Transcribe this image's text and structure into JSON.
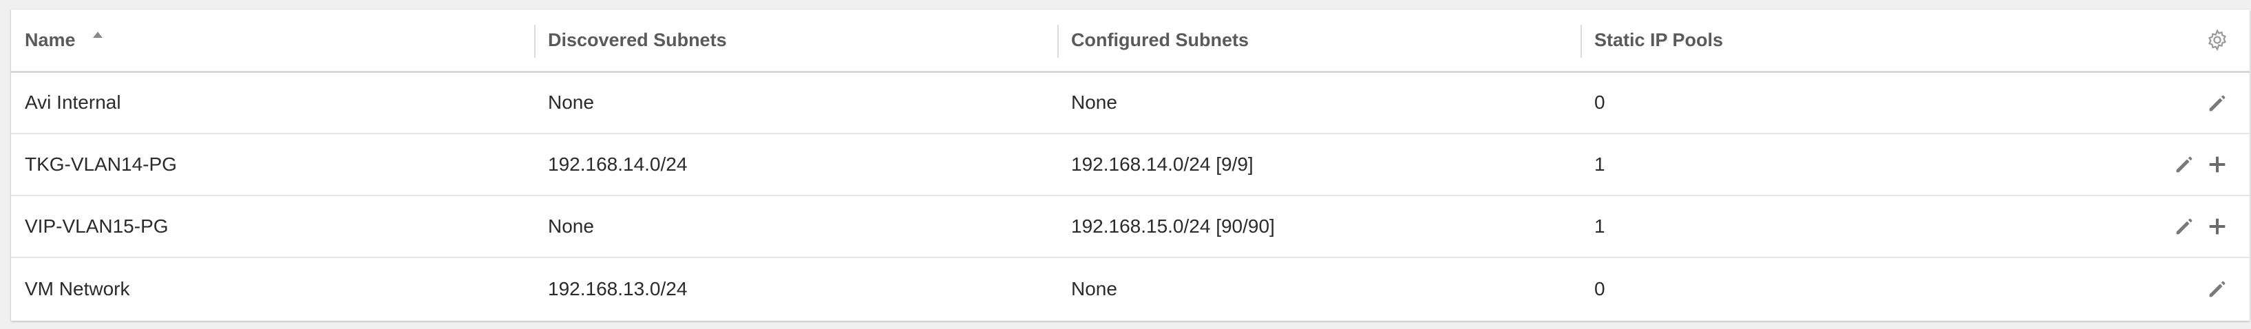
{
  "table": {
    "columns": {
      "name": "Name",
      "discovered": "Discovered Subnets",
      "configured": "Configured Subnets",
      "pools": "Static IP Pools"
    },
    "sort": {
      "column": "name",
      "direction": "ascending"
    },
    "settings_icon": "gear-icon",
    "rows": [
      {
        "name": "Avi Internal",
        "discovered": "None",
        "configured": "None",
        "pools": "0",
        "actions": [
          "edit"
        ]
      },
      {
        "name": "TKG-VLAN14-PG",
        "discovered": "192.168.14.0/24",
        "configured": "192.168.14.0/24 [9/9]",
        "pools": "1",
        "actions": [
          "edit",
          "add"
        ]
      },
      {
        "name": "VIP-VLAN15-PG",
        "discovered": "None",
        "configured": "192.168.15.0/24 [90/90]",
        "pools": "1",
        "actions": [
          "edit",
          "add"
        ]
      },
      {
        "name": "VM Network",
        "discovered": "192.168.13.0/24",
        "configured": "None",
        "pools": "0",
        "actions": [
          "edit"
        ]
      }
    ]
  },
  "icons": {
    "edit": "pencil-icon",
    "add": "plus-icon"
  },
  "colors": {
    "header_text": "#5a5a5a",
    "icon": "#7a7a7a",
    "row_border": "#e6e6e6"
  }
}
